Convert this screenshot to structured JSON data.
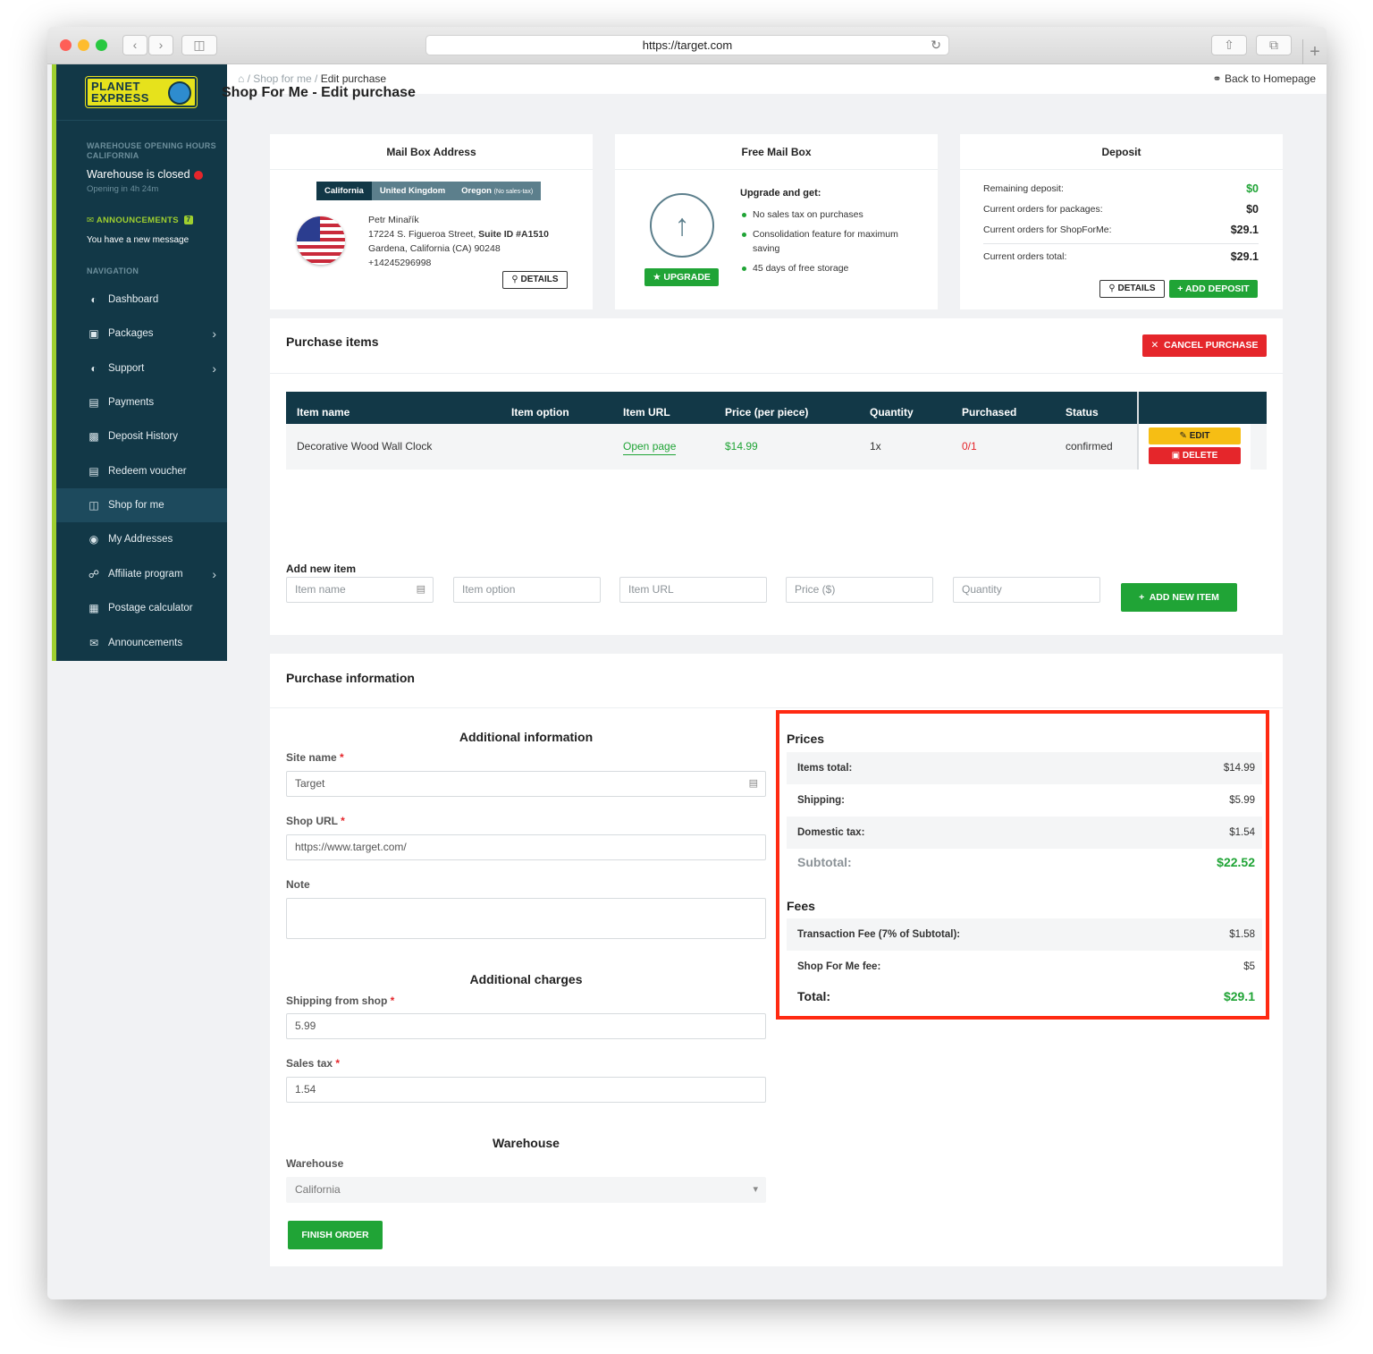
{
  "browser": {
    "url": "https://target.com"
  },
  "sidebar": {
    "logo_line1": "PLANET",
    "logo_line2": "EXPRESS",
    "hours_head": "WAREHOUSE OPENING HOURS",
    "hours_region": "CALIFORNIA",
    "status": "Warehouse is closed",
    "opening": "Opening in 4h 24m",
    "announcements_head": "ANNOUNCEMENTS",
    "announcements_count": "7",
    "announcements_text": "You have a new message",
    "nav_head": "NAVIGATION",
    "items": [
      {
        "label": "Dashboard",
        "icon": "gauge-icon"
      },
      {
        "label": "Packages",
        "icon": "box-icon"
      },
      {
        "label": "Support",
        "icon": "gauge-icon"
      },
      {
        "label": "Payments",
        "icon": "payment-icon"
      },
      {
        "label": "Deposit History",
        "icon": "wallet-icon"
      },
      {
        "label": "Redeem voucher",
        "icon": "voucher-icon"
      },
      {
        "label": "Shop for me",
        "icon": "bag-icon"
      },
      {
        "label": "My Addresses",
        "icon": "pin-icon"
      },
      {
        "label": "Affiliate program",
        "icon": "network-icon"
      },
      {
        "label": "Postage calculator",
        "icon": "calculator-icon"
      },
      {
        "label": "Announcements",
        "icon": "envelope-icon"
      }
    ]
  },
  "topbar": {
    "crumb_sep": "/",
    "crumb_parent": "Shop for me",
    "crumb_current": "Edit purchase",
    "back_home": "Back to Homepage"
  },
  "page": {
    "title": "Shop For Me - Edit purchase"
  },
  "mailbox": {
    "title": "Mail Box Address",
    "tabs": [
      "California",
      "United Kingdom",
      "Oregon"
    ],
    "oregon_note": "(No sales-tax)",
    "name": "Petr Minařík",
    "street": "17224 S. Figueroa Street, ",
    "suite": "Suite ID #A1510",
    "city": "Gardena, California (CA) 90248",
    "phone": "+14245296998",
    "details_btn": "DETAILS"
  },
  "freebox": {
    "title": "Free Mail Box",
    "upgrade_title": "Upgrade and get:",
    "benefits": [
      "No sales tax on purchases",
      "Consolidation feature for maximum saving",
      "45 days of free storage"
    ],
    "upgrade_btn": "UPGRADE"
  },
  "deposit": {
    "title": "Deposit",
    "rows": [
      {
        "label": "Remaining deposit:",
        "value": "$0"
      },
      {
        "label": "Current orders for packages:",
        "value": "$0"
      },
      {
        "label": "Current orders for ShopForMe:",
        "value": "$29.1"
      }
    ],
    "total_label": "Current orders total:",
    "total_value": "$29.1",
    "details_btn": "DETAILS",
    "add_btn": "ADD DEPOSIT"
  },
  "purchase_items": {
    "title": "Purchase items",
    "cancel_btn": "CANCEL PURCHASE",
    "columns": [
      "Item name",
      "Item option",
      "Item URL",
      "Price (per piece)",
      "Quantity",
      "Purchased",
      "Status"
    ],
    "rows": [
      {
        "name": "Decorative Wood Wall Clock",
        "option": "",
        "url": "Open page",
        "price": "$14.99",
        "quantity": "1x",
        "purchased": "0/1",
        "status": "confirmed"
      }
    ],
    "edit_btn": "EDIT",
    "delete_btn": "DELETE",
    "add_title": "Add new item",
    "placeholders": {
      "name": "Item name",
      "option": "Item option",
      "url": "Item URL",
      "price": "Price ($)",
      "quantity": "Quantity"
    },
    "add_btn": "ADD NEW ITEM"
  },
  "purchase_info": {
    "title": "Purchase information",
    "additional_info": "Additional information",
    "site_name_label": "Site name",
    "site_name_value": "Target",
    "shop_url_label": "Shop URL",
    "shop_url_value": "https://www.target.com/",
    "note_label": "Note",
    "note_value": "",
    "additional_charges": "Additional charges",
    "shipping_label": "Shipping from shop",
    "shipping_value": "5.99",
    "tax_label": "Sales tax",
    "tax_value": "1.54",
    "warehouse_head": "Warehouse",
    "warehouse_label": "Warehouse",
    "warehouse_value": "California",
    "finish_btn": "FINISH ORDER",
    "required_mark": "*"
  },
  "prices": {
    "title": "Prices",
    "items_total_label": "Items total:",
    "items_total": "$14.99",
    "shipping_label": "Shipping:",
    "shipping": "$5.99",
    "tax_label": "Domestic tax:",
    "tax": "$1.54",
    "subtotal_label": "Subtotal:",
    "subtotal": "$22.52",
    "fees_title": "Fees",
    "transaction_label": "Transaction Fee (7% of Subtotal):",
    "transaction": "$1.58",
    "sfm_label": "Shop For Me fee:",
    "sfm": "$5",
    "total_label": "Total:",
    "total": "$29.1"
  },
  "colors": {
    "sidebar": "#123847",
    "accent_green": "#20a436",
    "danger": "#e5262b",
    "warning": "#f6be14",
    "highlight": "#ff2a12"
  }
}
